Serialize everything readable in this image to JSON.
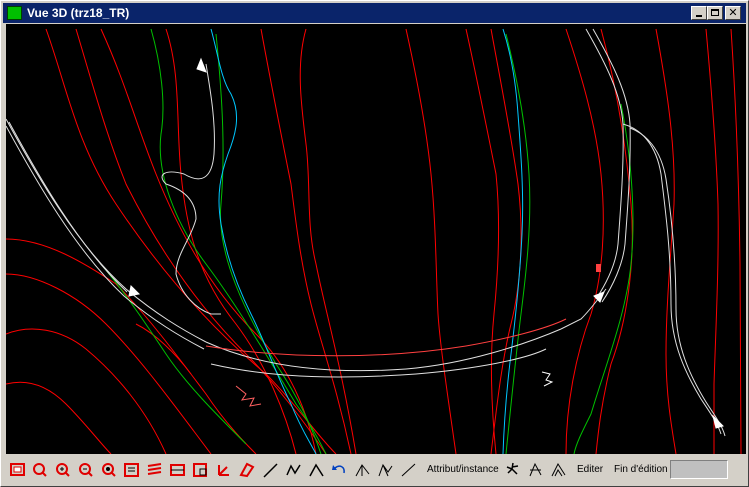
{
  "window": {
    "title": "Vue 3D (trz18_TR)",
    "controls": [
      "minimize",
      "maximize",
      "close"
    ],
    "close_glyph": "✕"
  },
  "viewport": {
    "background": "#000000",
    "line_colors": {
      "contour_major": "#ff0000",
      "contour_minor": "#00c000",
      "river": "#00c8ff",
      "road": "#e0e0e0",
      "arc_highlight": "#ff4040"
    }
  },
  "toolbar": {
    "tools_group1": [
      "zoom-window-icon",
      "zoom-in-icon",
      "zoom-plus-icon",
      "zoom-minus-icon",
      "zoom-previous-icon",
      "zoom-extents-icon",
      "layers-icon",
      "section-icon",
      "grid-icon",
      "axes-icon",
      "edit-3d-icon"
    ],
    "tools_group2": [
      "line-icon",
      "polyline-icon",
      "roof-icon",
      "undo-icon",
      "elevation-a-icon",
      "elevation-b-icon",
      "slope-icon"
    ],
    "attribut_label": "Attribut/instance",
    "tools_group3": [
      "walker-icon",
      "measure-icon",
      "profile-icon"
    ],
    "editer_label": "Editer",
    "fin_label": "Fin d'édition",
    "status_value": ""
  }
}
